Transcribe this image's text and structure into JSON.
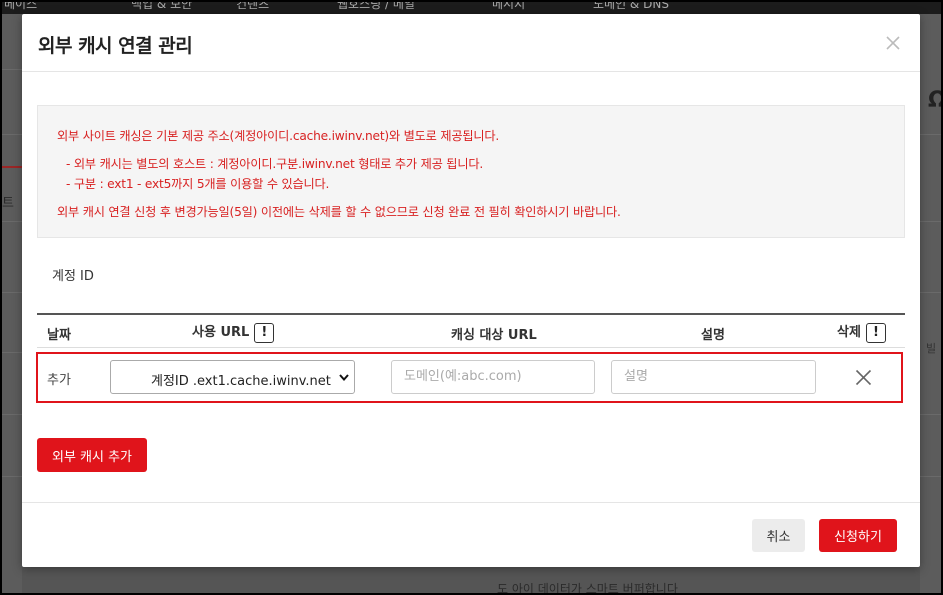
{
  "background": {
    "nav_items": [
      "베이스",
      "백업 & 보안",
      "컨텐츠",
      "웹호스팅 / 메일",
      "메시지",
      "도메인 & DNS"
    ],
    "left_fragment": "트",
    "right_glyph": "Ω",
    "right_fragment": "빌",
    "bottom_fragment": "도 아이 데이터가 스마트 버퍼합니다"
  },
  "modal": {
    "title": "외부 캐시 연결 관리",
    "close_label": "×",
    "notice": {
      "line1": "외부 사이트 캐싱은 기본 제공 주소(계정아이디.cache.iwinv.net)와 별도로 제공됩니다.",
      "line2": "- 외부 캐시는 별도의 호스트 : 계정아이디.구분.iwinv.net 형태로 추가 제공 됩니다.",
      "line3": "- 구분 : ext1 - ext5까지 5개를 이용할 수 있습니다.",
      "line4": "외부 캐시 연결 신청 후 변경가능일(5일) 이전에는 삭제를 할 수 없으므로 신청 완료 전 필히 확인하시기 바랍니다."
    },
    "account_label": "계정 ID",
    "table": {
      "headers": {
        "date": "날짜",
        "url": "사용 URL",
        "target": "캐싱 대상 URL",
        "desc": "설명",
        "delete": "삭제"
      },
      "info_glyph": "!",
      "row": {
        "label": "추가",
        "url_selected": "계정ID .ext1.cache.iwinv.net",
        "domain_placeholder": "도메인(예:abc.com)",
        "desc_placeholder": "설명"
      }
    },
    "add_button": "외부 캐시 추가",
    "cancel_button": "취소",
    "submit_button": "신청하기"
  },
  "colors": {
    "accent": "#e0141b",
    "notice_text": "#d82222"
  }
}
